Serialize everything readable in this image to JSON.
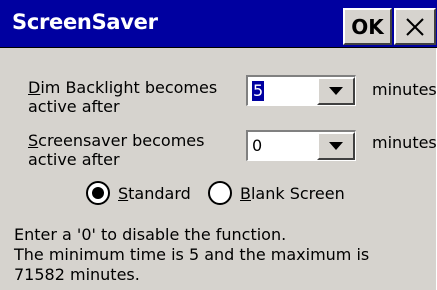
{
  "window": {
    "title": "ScreenSaver",
    "ok_label": "OK",
    "close_icon": "close-icon"
  },
  "dim_backlight": {
    "label_accel": "D",
    "label_rest": "im Backlight becomes",
    "label_line2": "active after",
    "value": "5",
    "unit": "minutes"
  },
  "screensaver": {
    "label_accel": "S",
    "label_rest": "creensaver becomes",
    "label_line2": "active after",
    "value": "0",
    "unit": "minutes"
  },
  "mode": {
    "standard_accel": "S",
    "standard_rest": "tandard",
    "blank_accel": "B",
    "blank_rest": "lank Screen",
    "selected": "Standard"
  },
  "info": {
    "line1": "Enter a '0' to disable the function.",
    "line2": "The minimum time is 5 and the maximum is",
    "line3": "71582 minutes."
  },
  "colors": {
    "titlebar": "#0000a0",
    "background": "#d6d3ce"
  }
}
